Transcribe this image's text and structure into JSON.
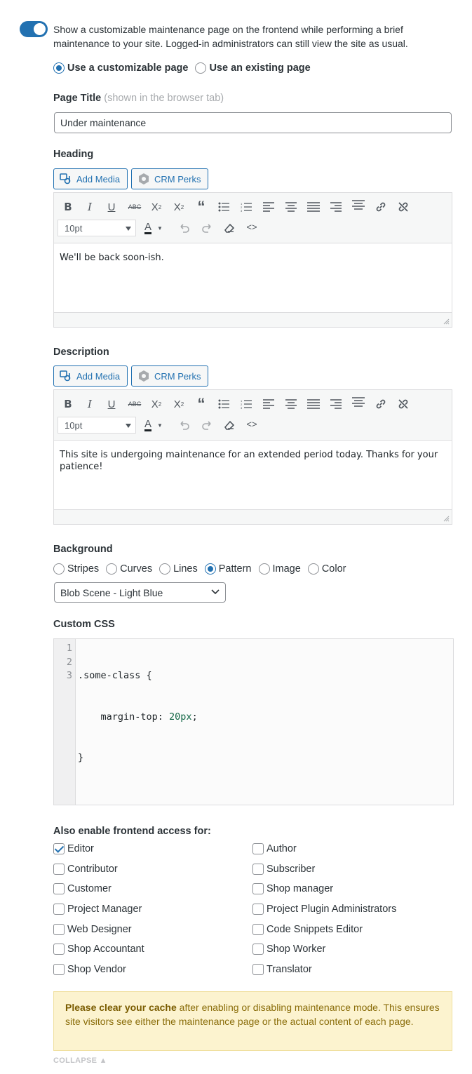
{
  "intro": "Show a customizable maintenance page on the frontend while performing a brief maintenance to your site. Logged-in administrators can still view the site as usual.",
  "page_mode": {
    "options": [
      "Use a customizable page",
      "Use an existing page"
    ],
    "selected": "Use a customizable page"
  },
  "page_title": {
    "label": "Page Title",
    "hint": "(shown in the browser tab)",
    "value": "Under maintenance"
  },
  "heading": {
    "label": "Heading",
    "add_media": "Add Media",
    "crm_perks": "CRM Perks",
    "font_size": "10pt",
    "content": "We'll be back soon-ish."
  },
  "description": {
    "label": "Description",
    "add_media": "Add Media",
    "crm_perks": "CRM Perks",
    "font_size": "10pt",
    "content": "This site is undergoing maintenance for an extended period today. Thanks for your patience!"
  },
  "background": {
    "label": "Background",
    "options": [
      "Stripes",
      "Curves",
      "Lines",
      "Pattern",
      "Image",
      "Color"
    ],
    "selected": "Pattern",
    "pattern_value": "Blob Scene - Light Blue"
  },
  "custom_css": {
    "label": "Custom CSS",
    "line_numbers": [
      "1",
      "2",
      "3"
    ],
    "line1": ".some-class {",
    "line2_prop": "    margin-top: ",
    "line2_val": "20px",
    "line2_end": ";",
    "line3": "}"
  },
  "access": {
    "label": "Also enable frontend access for:",
    "roles": [
      {
        "name": "Editor",
        "checked": true
      },
      {
        "name": "Author",
        "checked": false
      },
      {
        "name": "Contributor",
        "checked": false
      },
      {
        "name": "Subscriber",
        "checked": false
      },
      {
        "name": "Customer",
        "checked": false
      },
      {
        "name": "Shop manager",
        "checked": false
      },
      {
        "name": "Project Manager",
        "checked": false
      },
      {
        "name": "Project Plugin Administrators",
        "checked": false
      },
      {
        "name": "Web Designer",
        "checked": false
      },
      {
        "name": "Code Snippets Editor",
        "checked": false
      },
      {
        "name": "Shop Accountant",
        "checked": false
      },
      {
        "name": "Shop Worker",
        "checked": false
      },
      {
        "name": "Shop Vendor",
        "checked": false
      },
      {
        "name": "Translator",
        "checked": false
      }
    ]
  },
  "notice": {
    "bold": "Please clear your cache",
    "rest": " after enabling or disabling maintenance mode. This ensures site visitors see either the maintenance page or the actual content of each page."
  },
  "collapse_label": "COLLAPSE ▲",
  "colors": {
    "accent": "#2271b1",
    "notice_bg": "#fcf3cf"
  }
}
